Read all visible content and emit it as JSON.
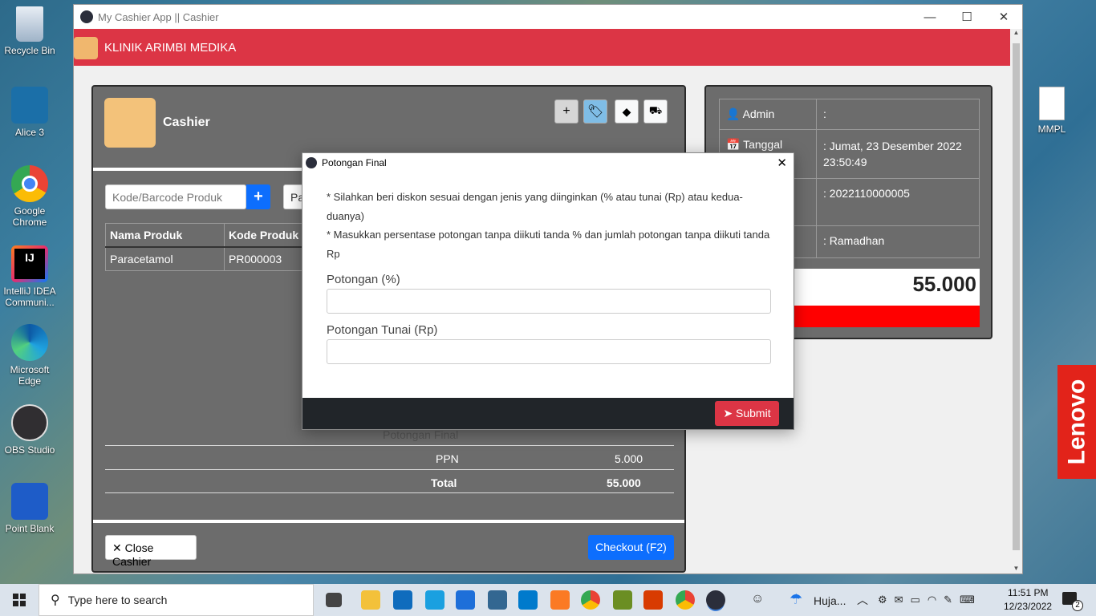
{
  "desktop": {
    "icons": [
      {
        "label": "Recycle Bin"
      },
      {
        "label": "Alice 3"
      },
      {
        "label": "Google Chrome"
      },
      {
        "label": "IntelliJ IDEA Communi..."
      },
      {
        "label": "Microsoft Edge"
      },
      {
        "label": "OBS Studio"
      },
      {
        "label": "Point Blank"
      }
    ],
    "right_icon": "MMPL",
    "brand": "Lenovo"
  },
  "window": {
    "title": "My Cashier App || Cashier",
    "minimize": "—",
    "maximize": "☐",
    "close": "✕"
  },
  "app": {
    "clinic_name": "KLINIK ARIMBI MEDIKA"
  },
  "cashier": {
    "title": "Cashier",
    "toolbar": {
      "add": "+"
    },
    "search_placeholder": "Kode/Barcode Produk",
    "add_btn": "+",
    "second_input_value": "Pa",
    "table": {
      "headers": [
        "Nama Produk",
        "Kode Produk"
      ],
      "rows": [
        [
          "Paracetamol",
          "PR000003"
        ]
      ]
    },
    "summary": {
      "potongan_final_label": "Potongan Final",
      "ppn_label": "PPN",
      "ppn_value": "5.000",
      "total_label": "Total",
      "total_value": "55.000"
    },
    "close_btn": "Close Cashier",
    "checkout_btn": "Checkout (F2)"
  },
  "info": {
    "admin_label": "Admin",
    "admin_value": ":",
    "tanggal_label": "Tanggal",
    "tanggal_value": ": Jumat, 23 Desember 2022 23:50:49",
    "no_value": ": 2022110000005",
    "name_value": ": Ramadhan",
    "grand_total": "55.000"
  },
  "modal": {
    "title": "Potongan Final",
    "close": "✕",
    "note1": "* Silahkan beri diskon sesuai dengan jenis yang diinginkan (% atau tunai (Rp) atau kedua-duanya)",
    "note2": "* Masukkan persentase potongan tanpa diikuti tanda % dan jumlah potongan tanpa diikuti tanda Rp",
    "percent_label": "Potongan (%)",
    "percent_value": "",
    "cash_label": "Potongan Tunai (Rp)",
    "cash_value": "",
    "submit": "Submit"
  },
  "taskbar": {
    "search_placeholder": "Type here to search",
    "weather": "Huja...",
    "time": "11:51 PM",
    "date": "12/23/2022",
    "notif_count": "2"
  },
  "colors": {
    "header_red": "#dc3545",
    "primary_blue": "#0d6efd",
    "panel_gray": "#6c6c6c",
    "footer_dark": "#212529",
    "bar_red": "#ff0000"
  }
}
